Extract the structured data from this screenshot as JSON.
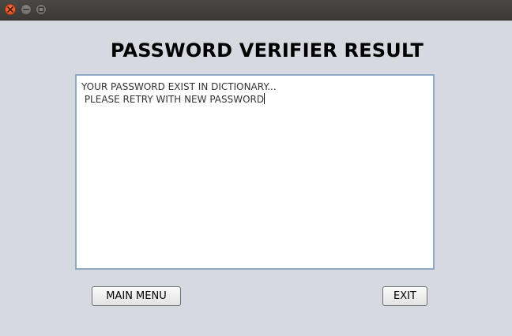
{
  "titlebar": {
    "buttons": [
      {
        "name": "close",
        "icon": "close-icon",
        "color": "#e0531f"
      },
      {
        "name": "minimize",
        "icon": "minimize-icon",
        "color": "#77756f"
      },
      {
        "name": "maximize",
        "icon": "maximize-icon",
        "color": "#77756f"
      }
    ]
  },
  "main": {
    "heading": "PASSWORD VERIFIER RESULT",
    "result_lines": [
      "YOUR PASSWORD EXIST IN DICTIONARY...",
      " PLEASE RETRY WITH NEW PASSWORD"
    ]
  },
  "buttons": {
    "main_menu_label": "MAIN MENU",
    "exit_label": "EXIT"
  },
  "colors": {
    "window_bg": "#d6d9df",
    "titlebar_bg": "#3f3e3a",
    "textarea_border": "#8fa9c4"
  }
}
